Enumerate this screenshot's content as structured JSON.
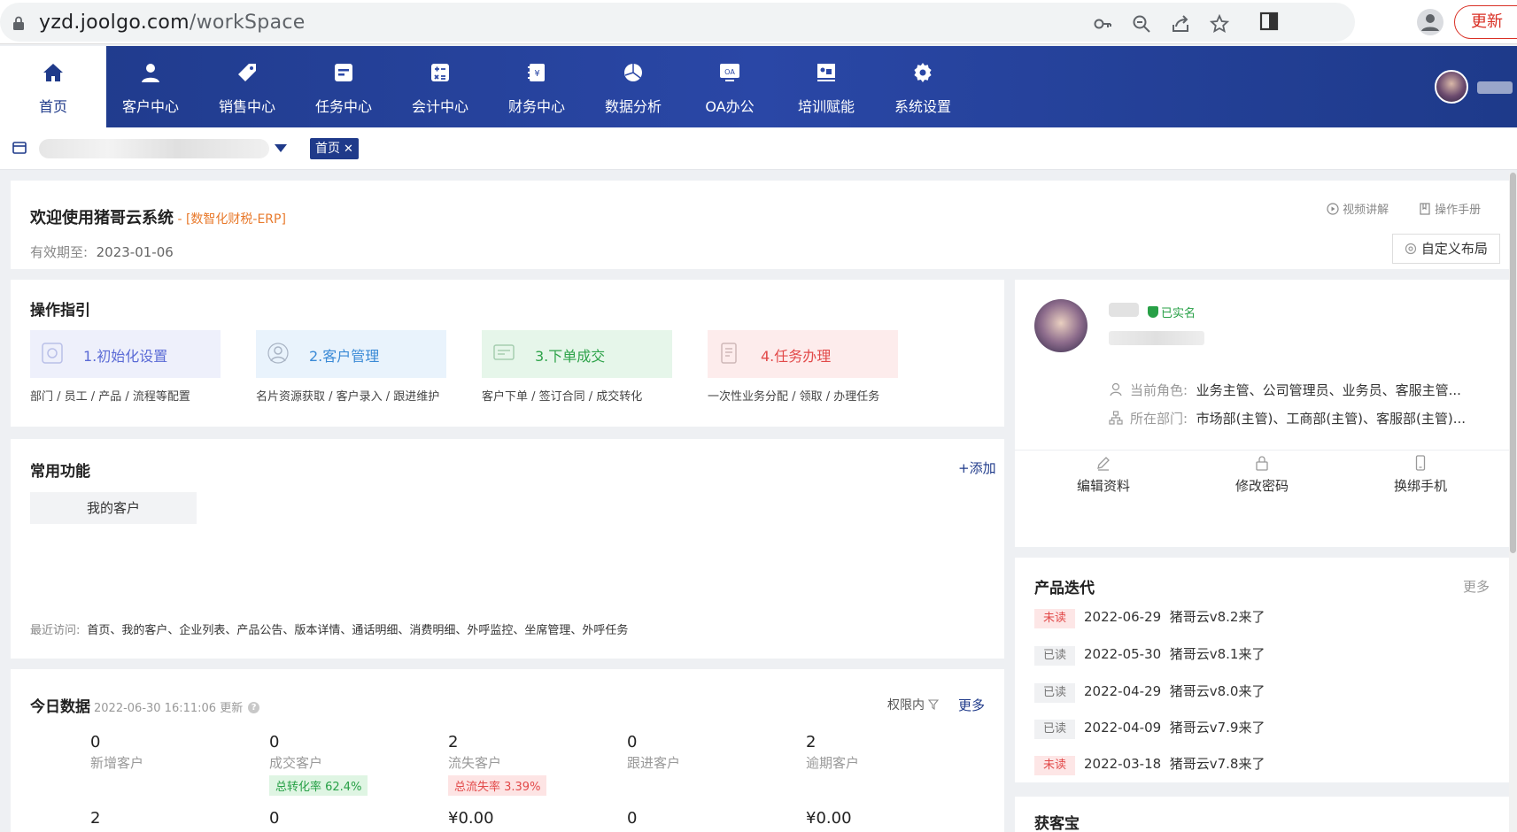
{
  "browser": {
    "url_host": "yzd.joolgo.com",
    "url_path": "/workSpace",
    "update_label": "更新"
  },
  "nav": {
    "items": [
      {
        "label": "首页",
        "icon": "home-icon",
        "active": true
      },
      {
        "label": "客户中心",
        "icon": "user-icon"
      },
      {
        "label": "销售中心",
        "icon": "tag-icon"
      },
      {
        "label": "任务中心",
        "icon": "task-icon"
      },
      {
        "label": "会计中心",
        "icon": "calculator-icon"
      },
      {
        "label": "财务中心",
        "icon": "finance-icon"
      },
      {
        "label": "数据分析",
        "icon": "pie-chart-icon"
      },
      {
        "label": "OA办公",
        "icon": "oa-icon"
      },
      {
        "label": "培训赋能",
        "icon": "training-icon"
      },
      {
        "label": "系统设置",
        "icon": "gear-icon"
      }
    ]
  },
  "tabs": {
    "home_tab": "首页",
    "close_glyph": "✕"
  },
  "welcome": {
    "title": "欢迎使用猪哥云系统",
    "tag": " - [数智化财税-ERP]",
    "valid_label": "有效期至:",
    "valid_date": "2023-01-06",
    "video_link": "视频讲解",
    "manual_link": "操作手册",
    "custom_layout": "自定义布局"
  },
  "guide": {
    "title": "操作指引",
    "steps": [
      {
        "label": "1.初始化设置",
        "desc": "部门 / 员工 / 产品 / 流程等配置",
        "color": "#5b6bd6",
        "bg": "#eef0fb"
      },
      {
        "label": "2.客户管理",
        "desc": "名片资源获取 / 客户录入 / 跟进维护",
        "color": "#3a8ad6",
        "bg": "#e9f3fc"
      },
      {
        "label": "3.下单成交",
        "desc": "客户下单 / 签订合同 / 成交转化",
        "color": "#2ea34a",
        "bg": "#e6f6ea"
      },
      {
        "label": "4.任务办理",
        "desc": "一次性业务分配 / 领取 / 办理任务",
        "color": "#e24a4a",
        "bg": "#fdecec"
      }
    ]
  },
  "common": {
    "title": "常用功能",
    "add_label": "+添加",
    "chips": [
      "我的客户"
    ],
    "recent_label": "最近访问:",
    "recent_items": "首页、我的客户、企业列表、产品公告、版本详情、通话明细、消费明细、外呼监控、坐席管理、外呼任务"
  },
  "today": {
    "title": "今日数据",
    "updated": "2022-06-30 16:11:06 更新",
    "help": "?",
    "perm": "权限内",
    "more": "更多",
    "row1": [
      {
        "num": "0",
        "label": "新增客户"
      },
      {
        "num": "0",
        "label": "成交客户",
        "badge": "总转化率 62.4%",
        "badge_type": "green"
      },
      {
        "num": "2",
        "label": "流失客户",
        "badge": "总流失率 3.39%",
        "badge_type": "red"
      },
      {
        "num": "0",
        "label": "跟进客户"
      },
      {
        "num": "2",
        "label": "逾期客户"
      }
    ],
    "row2": [
      "2",
      "0",
      "¥0.00",
      "0",
      "¥0.00"
    ]
  },
  "profile": {
    "verified": "已实名",
    "role_label": "当前角色:",
    "role_value": "业务主管、公司管理员、业务员、客服主管...",
    "dept_label": "所在部门:",
    "dept_value": "市场部(主管)、工商部(主管)、客服部(主管)...",
    "actions": [
      "编辑资料",
      "修改密码",
      "换绑手机"
    ]
  },
  "product": {
    "title": "产品迭代",
    "more": "更多",
    "items": [
      {
        "status": "未读",
        "unread": true,
        "date": "2022-06-29",
        "text": "猪哥云v8.2来了"
      },
      {
        "status": "已读",
        "unread": false,
        "date": "2022-05-30",
        "text": "猪哥云v8.1来了"
      },
      {
        "status": "已读",
        "unread": false,
        "date": "2022-04-29",
        "text": "猪哥云v8.0来了"
      },
      {
        "status": "已读",
        "unread": false,
        "date": "2022-04-09",
        "text": "猪哥云v7.9来了"
      },
      {
        "status": "未读",
        "unread": true,
        "date": "2022-03-18",
        "text": "猪哥云v7.8来了"
      }
    ]
  },
  "huokebao": {
    "title": "获客宝"
  }
}
